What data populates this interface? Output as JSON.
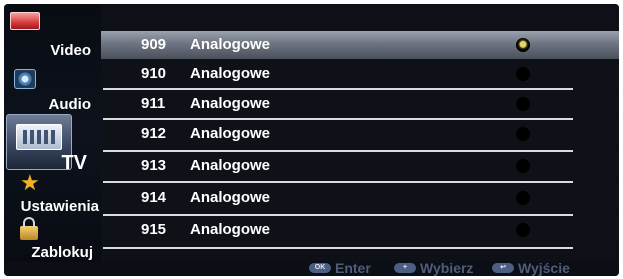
{
  "sidebar": {
    "items": [
      {
        "label": "Video",
        "icon": "video-icon"
      },
      {
        "label": "Audio",
        "icon": "speaker-icon"
      },
      {
        "label": "TV",
        "icon": "tv-icon",
        "selected": true
      },
      {
        "label": "Ustawienia",
        "icon": "star-icon"
      },
      {
        "label": "Zablokuj",
        "icon": "lock-icon"
      }
    ]
  },
  "channels": [
    {
      "number": "909",
      "name": "Analogowe",
      "selected": true
    },
    {
      "number": "910",
      "name": "Analogowe"
    },
    {
      "number": "911",
      "name": "Analogowe"
    },
    {
      "number": "912",
      "name": "Analogowe"
    },
    {
      "number": "913",
      "name": "Analogowe"
    },
    {
      "number": "914",
      "name": "Analogowe"
    },
    {
      "number": "915",
      "name": "Analogowe"
    }
  ],
  "footer": {
    "hints": [
      {
        "button": "OK",
        "label": "Enter"
      },
      {
        "button": "+",
        "label": "Wybierz"
      },
      {
        "button": "↩",
        "label": "Wyjście"
      }
    ]
  },
  "colors": {
    "background": "#0f1218",
    "highlight": "#9aa1ad",
    "text": "#ffffff",
    "hint_text": "#4f5c7a"
  }
}
